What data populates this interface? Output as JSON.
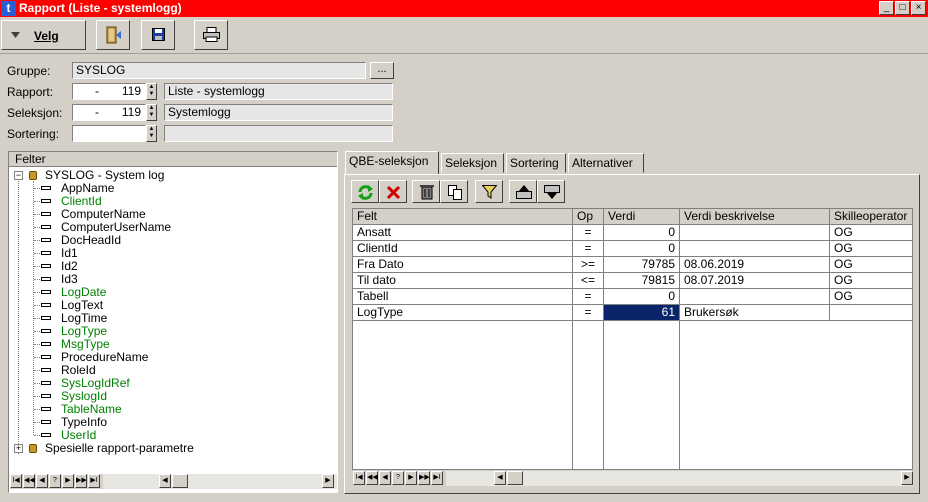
{
  "window": {
    "title": "Rapport (Liste - systemlogg)",
    "app_icon_letter": "t",
    "min_glyph": "_",
    "max_glyph": "□",
    "close_glyph": "×"
  },
  "toolbar": {
    "velg_label": "Velg"
  },
  "form": {
    "gruppe_label": "Gruppe:",
    "gruppe_value": "SYSLOG",
    "gruppe_browse": "...",
    "rapport_label": "Rapport:",
    "rapport_prefix": "-",
    "rapport_number": "119",
    "rapport_name": "Liste - systemlogg",
    "seleksjon_label": "Seleksjon:",
    "seleksjon_prefix": "-",
    "seleksjon_number": "119",
    "seleksjon_name": "Systemlogg",
    "sortering_label": "Sortering:",
    "sortering_value": "",
    "sortering_name": ""
  },
  "tree": {
    "header": "Felter",
    "root_label": "SYSLOG - System log",
    "items": [
      {
        "label": "AppName",
        "green": false
      },
      {
        "label": "ClientId",
        "green": true
      },
      {
        "label": "ComputerName",
        "green": false
      },
      {
        "label": "ComputerUserName",
        "green": false
      },
      {
        "label": "DocHeadId",
        "green": false
      },
      {
        "label": "Id1",
        "green": false
      },
      {
        "label": "Id2",
        "green": false
      },
      {
        "label": "Id3",
        "green": false
      },
      {
        "label": "LogDate",
        "green": true
      },
      {
        "label": "LogText",
        "green": false
      },
      {
        "label": "LogTime",
        "green": false
      },
      {
        "label": "LogType",
        "green": true
      },
      {
        "label": "MsgType",
        "green": true
      },
      {
        "label": "ProcedureName",
        "green": false
      },
      {
        "label": "RoleId",
        "green": false
      },
      {
        "label": "SysLogIdRef",
        "green": true
      },
      {
        "label": "SyslogId",
        "green": true
      },
      {
        "label": "TableName",
        "green": true
      },
      {
        "label": "TypeInfo",
        "green": false
      },
      {
        "label": "UserId",
        "green": true
      }
    ],
    "second_root_label": "Spesielle rapport-parametre"
  },
  "nav": {
    "first": "I◀",
    "prev_page": "◀◀",
    "prev": "◀",
    "query": "?",
    "next": "▶",
    "next_page": "▶▶",
    "last": "▶I",
    "scroll_left": "◀",
    "scroll_right": "▶"
  },
  "tabs": [
    {
      "label": "QBE-seleksjon"
    },
    {
      "label": "Seleksjon"
    },
    {
      "label": "Sortering"
    },
    {
      "label": "Alternativer"
    }
  ],
  "grid": {
    "columns": [
      "Felt",
      "Op",
      "Verdi",
      "Verdi beskrivelse",
      "Skilleoperator"
    ],
    "rows": [
      {
        "felt": "Ansatt",
        "op": "=",
        "verdi": "0",
        "beskrivelse": "",
        "skille": "OG"
      },
      {
        "felt": "ClientId",
        "op": "=",
        "verdi": "0",
        "beskrivelse": "",
        "skille": "OG"
      },
      {
        "felt": "Fra Dato",
        "op": ">=",
        "verdi": "79785",
        "beskrivelse": "08.06.2019",
        "skille": "OG"
      },
      {
        "felt": "Til dato",
        "op": "<=",
        "verdi": "79815",
        "beskrivelse": "08.07.2019",
        "skille": "OG"
      },
      {
        "felt": "Tabell",
        "op": "=",
        "verdi": "0",
        "beskrivelse": "",
        "skille": "OG"
      },
      {
        "felt": "LogType",
        "op": "=",
        "verdi": "61",
        "beskrivelse": "Brukersøk",
        "skille": ""
      }
    ]
  },
  "colors": {
    "title_bar": "#ff0000",
    "selection": "#0a246a",
    "green_text": "#008000"
  }
}
